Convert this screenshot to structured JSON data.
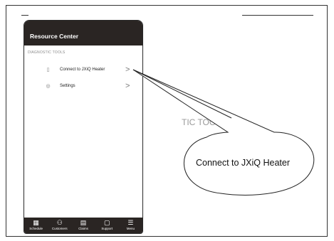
{
  "app": {
    "title": "Resource Center",
    "section_label": "DIAGNOSTIC TOOLS"
  },
  "menu": [
    {
      "icon": "phone-icon",
      "label": "Connect to JXiQ Heater",
      "chevron": ">"
    },
    {
      "icon": "gear-icon",
      "label": "Settings",
      "chevron": ">"
    }
  ],
  "tabbar": [
    {
      "icon": "calendar-icon",
      "label": "Schedule"
    },
    {
      "icon": "customers-icon",
      "label": "Customers"
    },
    {
      "icon": "claims-icon",
      "label": "Claims"
    },
    {
      "icon": "chat-icon",
      "label": "Support"
    },
    {
      "icon": "hamburger-icon",
      "label": "Menu"
    }
  ],
  "background_heading": "TIC TOOLS",
  "callout": {
    "text": "Connect to JXiQ Heater"
  }
}
